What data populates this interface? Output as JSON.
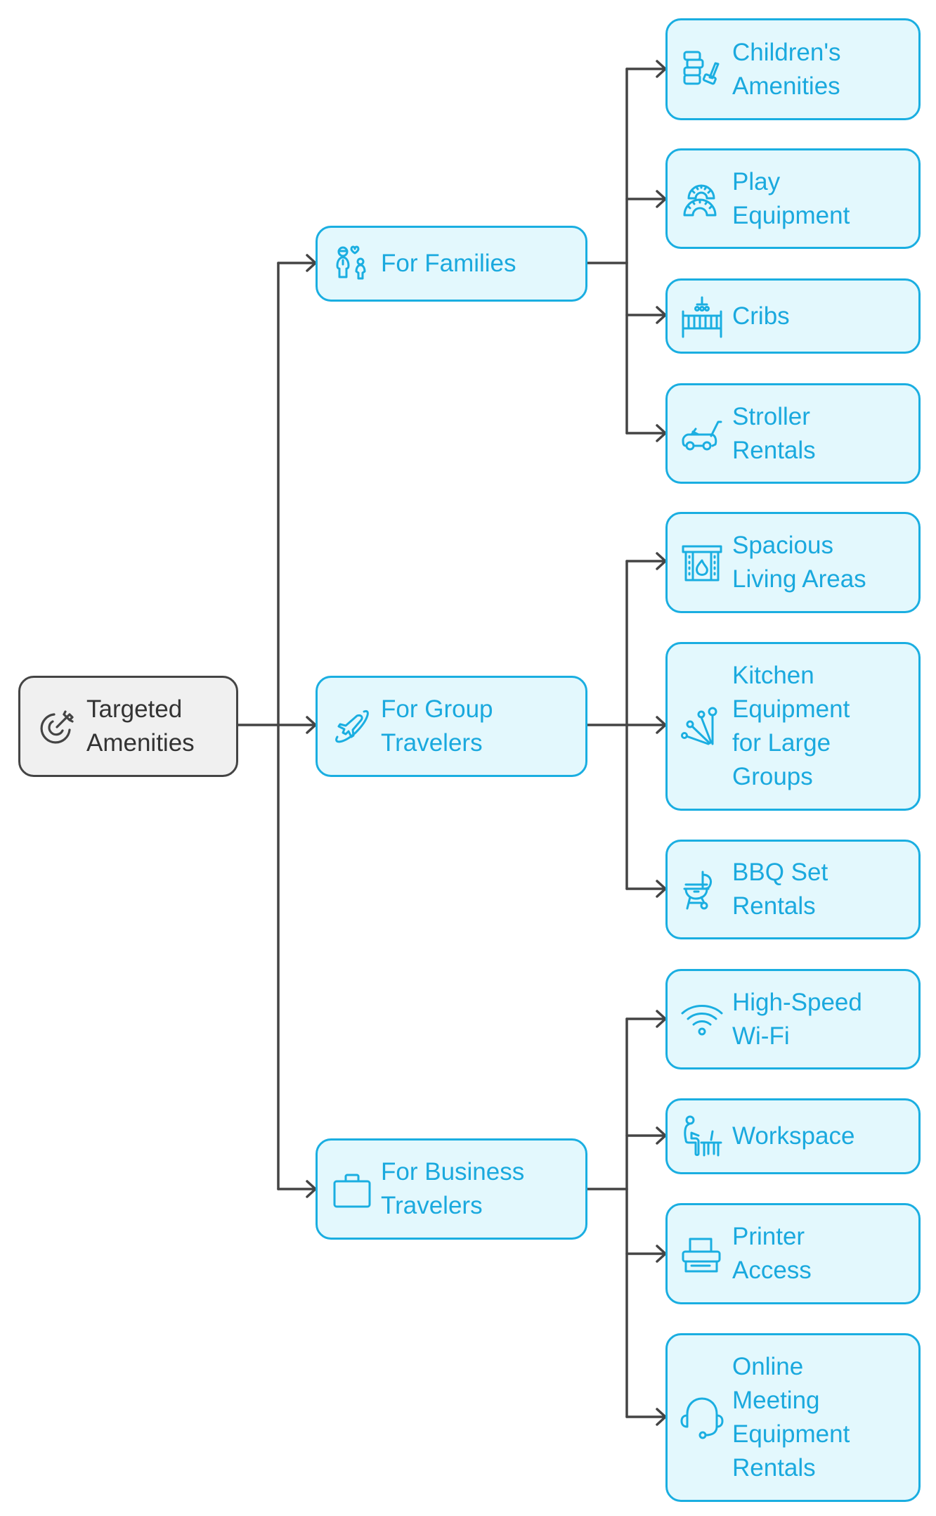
{
  "diagram": {
    "colors": {
      "accent": "#1aaee1",
      "accent_fill": "#e3f8fd",
      "accent_text": "#1aa9de",
      "root_fill": "#f0f0f0",
      "root_border": "#444444",
      "connector": "#444444"
    },
    "root": {
      "label": "Targeted\nAmenities",
      "icon": "target-arrow-icon"
    },
    "categories": [
      {
        "label": "For Families",
        "icon": "family-icon",
        "items": [
          {
            "label": "Children's\nAmenities",
            "icon": "toy-blocks-icon"
          },
          {
            "label": "Play\nEquipment",
            "icon": "play-dome-icon"
          },
          {
            "label": "Cribs",
            "icon": "crib-icon"
          },
          {
            "label": "Stroller\nRentals",
            "icon": "stroller-icon"
          }
        ]
      },
      {
        "label": "For Group\nTravelers",
        "icon": "plane-orbit-icon",
        "items": [
          {
            "label": "Spacious\nLiving Areas",
            "icon": "fireplace-icon"
          },
          {
            "label": "Kitchen\nEquipment\nfor Large\nGroups",
            "icon": "kitchen-utensils-icon"
          },
          {
            "label": "BBQ Set\nRentals",
            "icon": "grill-icon"
          }
        ]
      },
      {
        "label": "For Business\nTravelers",
        "icon": "briefcase-icon",
        "items": [
          {
            "label": "High-Speed\nWi-Fi",
            "icon": "wifi-icon"
          },
          {
            "label": "Workspace",
            "icon": "desk-worker-icon"
          },
          {
            "label": "Printer\nAccess",
            "icon": "printer-icon"
          },
          {
            "label": "Online\nMeeting\nEquipment\nRentals",
            "icon": "headset-icon"
          }
        ]
      }
    ]
  }
}
